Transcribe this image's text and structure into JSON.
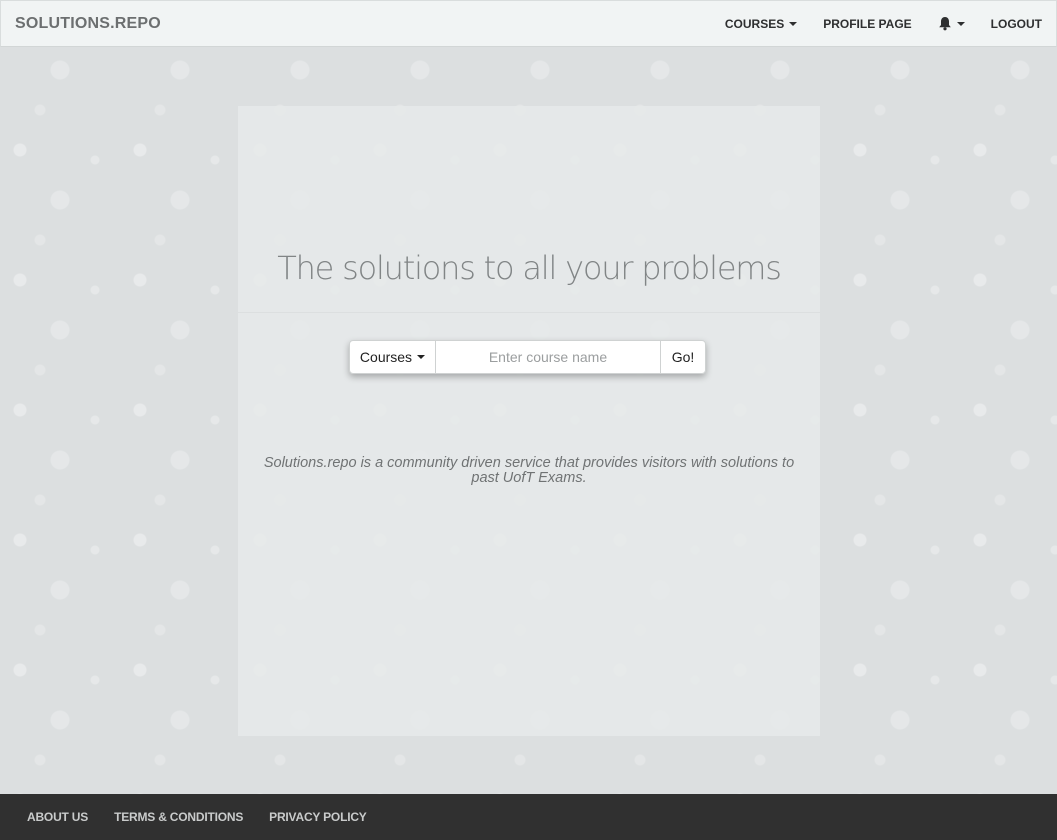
{
  "navbar": {
    "brand": "SOLUTIONS.REPO",
    "courses_label": "COURSES",
    "profile_label": "PROFILE PAGE",
    "notifications_icon": "bell-icon",
    "logout_label": "LOGOUT"
  },
  "hero": {
    "headline": "The solutions to all your problems",
    "dropdown_label": "Courses",
    "search_placeholder": "Enter course name",
    "go_label": "Go!",
    "tagline": "Solutions.repo is a community driven service that provides visitors with solutions to past UofT Exams."
  },
  "footer": {
    "links": [
      "ABOUT US",
      "TERMS & CONDITIONS",
      "PRIVACY POLICY"
    ]
  },
  "colors": {
    "navbar_bg": "#f1f4f4",
    "footer_bg": "#303030",
    "page_bg": "#dcdfe0"
  }
}
